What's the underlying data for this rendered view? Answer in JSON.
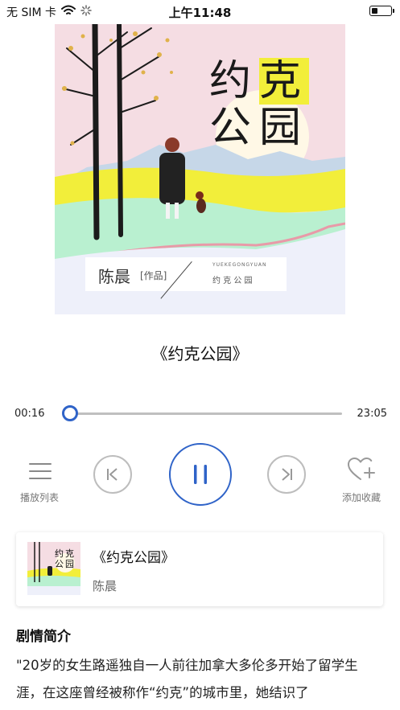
{
  "status_bar": {
    "carrier": "无 SIM 卡",
    "time": "上午11:48"
  },
  "cover": {
    "title_chars": [
      "约",
      "克",
      "公",
      "园"
    ],
    "author": "陈晨",
    "author_tag": "[作品]",
    "pinyin": "YUEKEGONGYUAN",
    "small_title": "约 克 公 园"
  },
  "track_title": "《约克公园》",
  "player": {
    "elapsed": "00:16",
    "duration": "23:05",
    "progress_fraction": 0.012,
    "playlist_label": "播放列表",
    "favorite_label": "添加收藏"
  },
  "album_card": {
    "title": "《约克公园》",
    "author": "陈晨",
    "thumb_chars": [
      "约",
      "克",
      "公",
      "园"
    ]
  },
  "synopsis": {
    "heading": "剧情简介",
    "text": "\"20岁的女生路遥独自一人前往加拿大多伦多开始了留学生涯，在这座曾经被称作“约克”的城市里，她结识了"
  },
  "colors": {
    "accent": "#2f63c8",
    "cover_yellow": "#f2ee3a",
    "cover_mint": "#b9f0d0"
  },
  "icons": [
    "wifi-icon",
    "loading-icon",
    "battery-icon",
    "playlist-icon",
    "previous-icon",
    "pause-icon",
    "next-icon",
    "heart-plus-icon"
  ]
}
